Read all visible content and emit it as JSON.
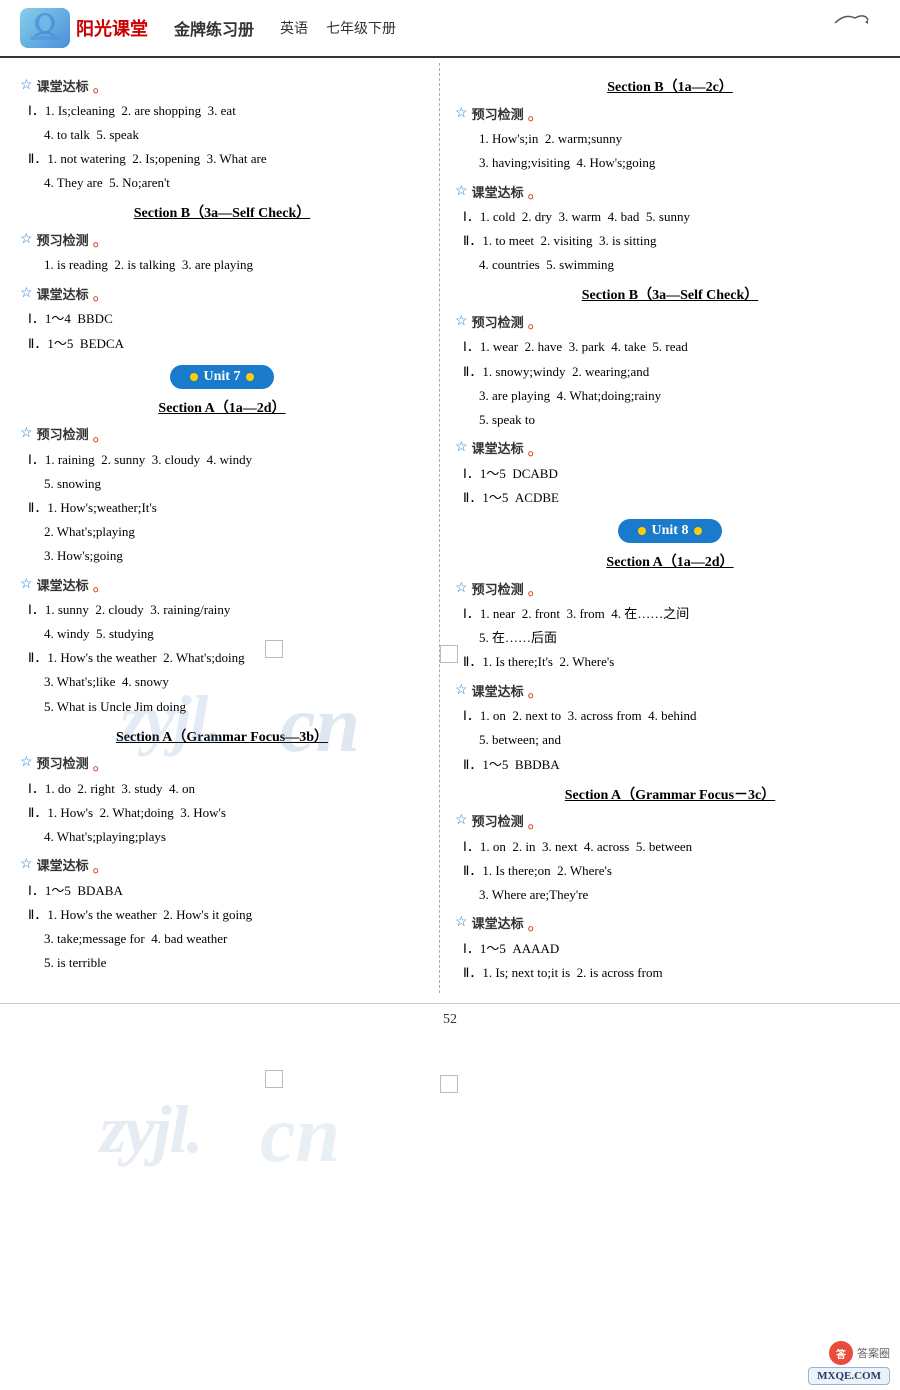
{
  "header": {
    "logo_emoji": "📚",
    "brand": "阳光课堂",
    "subtitle": "金牌练习册",
    "subject": "英语",
    "grade": "七年级下册",
    "bird": "✈"
  },
  "page_number": "52",
  "left_column": {
    "section_b_3a_self_check_label": "Section B（3a—Self Check）",
    "yuxi_label": "☆预习检测。",
    "ketang_label": "☆课堂达标。",
    "unit7_label": "Unit 7",
    "section_a_1a2d_label": "Section A（1a—2d）",
    "unit7": {
      "sb_3a_self_check": {
        "yuxi": {
          "lines": [
            "Ⅰ．1. Is;cleaning  2. are shopping  3. eat",
            "   4. to talk  5. speak",
            "Ⅱ．1. not watering  2. Is;opening  3. What are",
            "   4. They are  5. No;aren't"
          ]
        },
        "section_title": "Section B（3a—Self Check）",
        "yuxi2": {
          "lines": [
            "1. is reading  2. is talking  3. are playing"
          ]
        },
        "ketang": {
          "lines": [
            "Ⅰ．1～4  BBDC",
            "Ⅱ．1～5  BEDCA"
          ]
        }
      },
      "section_a_1a2d": {
        "yuxi": {
          "lines": [
            "Ⅰ．1. raining  2. sunny  3. cloudy  4. windy",
            "   5. snowing",
            "Ⅱ．1. How's;weather;It's",
            "   2. What's;playing",
            "   3. How's;going"
          ]
        },
        "ketang": {
          "lines": [
            "Ⅰ．1. sunny  2. cloudy  3. raining/rainy",
            "   4. windy  5. studying",
            "Ⅱ．1. How's the weather  2. What's;doing",
            "   3. What's;like  4. snowy",
            "   5. What is Uncle Jim doing"
          ]
        }
      },
      "section_a_grammar_label": "Section A（Grammar Focus—3b）",
      "section_a_grammar": {
        "yuxi": {
          "lines": [
            "Ⅰ．1. do  2. right  3. study  4. on",
            "Ⅱ．1. How's  2. What;doing  3. How's",
            "   4. What's;playing;plays"
          ]
        },
        "ketang": {
          "lines": [
            "Ⅰ．1～5  BDABA",
            "Ⅱ．1. How's the weather  2. How's it going",
            "   3. take;message for  4. bad weather",
            "   5. is terrible"
          ]
        }
      }
    }
  },
  "right_column": {
    "section_b_1a2c_label": "Section B（1a—2c）",
    "unit8_label": "Unit 8",
    "unit7_right": {
      "section_b_1a2c": {
        "yuxi": {
          "lines": [
            "1. How's;in  2. warm;sunny",
            "3. having;visiting  4. How's;going"
          ]
        },
        "ketang": {
          "lines": [
            "Ⅰ．1. cold  2. dry  3. warm  4. bad  5. sunny",
            "Ⅱ．1. to meet  2. visiting  3. is sitting",
            "   4. countries  5. swimming"
          ]
        },
        "section_3a_label": "Section B（3a—Self Check）",
        "yuxi2": {
          "lines": [
            "Ⅰ．1. wear  2. have  3. park  4. take  5. read",
            "Ⅱ．1. snowy;windy  2. wearing;and",
            "   3. are playing  4. What;doing;rainy",
            "   5. speak to"
          ]
        },
        "ketang2": {
          "lines": [
            "Ⅰ．1～5  DCABD",
            "Ⅱ．1～5  ACDBE"
          ]
        }
      },
      "unit8": {
        "section_a_1a2d_label": "Section A（1a—2d）",
        "yuxi": {
          "lines": [
            "Ⅰ．1. near  2. front  3. from  4. 在……之间",
            "   5. 在……后面",
            "Ⅱ．1. Is there;It's  2. Where's"
          ]
        },
        "ketang": {
          "lines": [
            "Ⅰ．1. on  2. next to  3. across from  4. behind",
            "   5. between; and",
            "Ⅱ．1～5  BBDBA"
          ]
        },
        "grammar_label": "Section A（Grammar Focus－3c）",
        "yuxi2": {
          "lines": [
            "Ⅰ．1. on  2. in  3. next  4. across  5. between",
            "Ⅱ．1. Is there;on  2. Where's",
            "   3. Where are;They're"
          ]
        },
        "ketang2": {
          "lines": [
            "Ⅰ．1～5  AAAAD",
            "Ⅱ．1. Is; next to;it is  2. is across from"
          ]
        }
      }
    }
  },
  "watermark_text": "zyjl.cn",
  "footer_page": "— 52 —",
  "bottom_logo": "MXQE.COM"
}
